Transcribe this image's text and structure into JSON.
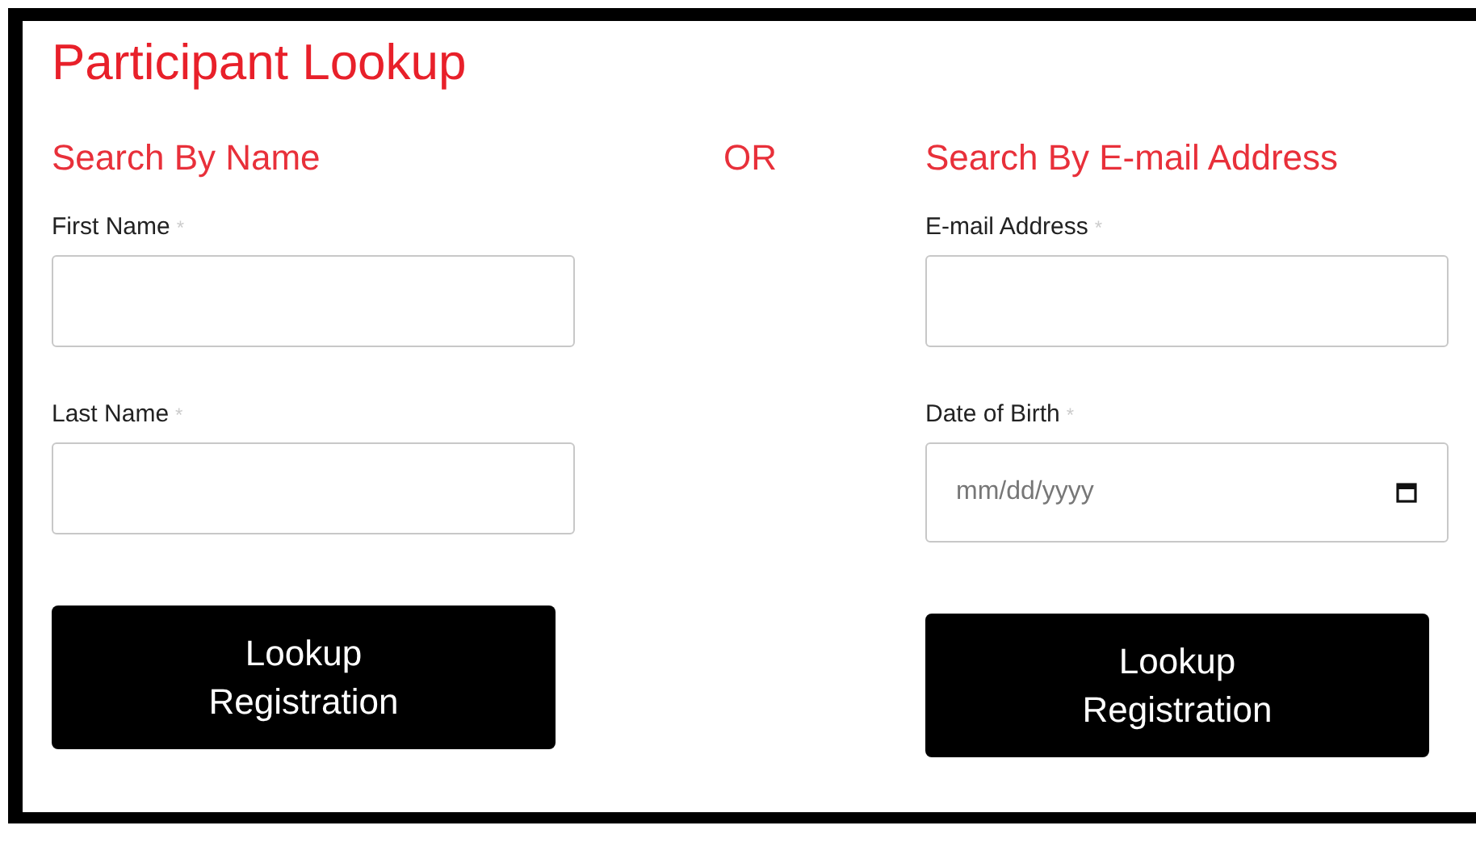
{
  "title": "Participant Lookup",
  "separator": "OR",
  "sections": [
    {
      "heading": "Search By Name",
      "fields": [
        {
          "kind": "text",
          "label": "First Name",
          "required_mark": "*"
        },
        {
          "kind": "text",
          "label": "Last Name",
          "required_mark": "*"
        }
      ],
      "button": "Lookup Registration"
    },
    {
      "heading": "Search By E-mail Address",
      "fields": [
        {
          "kind": "text",
          "label": "E-mail Address",
          "required_mark": "*"
        },
        {
          "kind": "date",
          "label": "Date of Birth",
          "required_mark": "*",
          "placeholder": "mm/dd/yyyy"
        }
      ],
      "button": "Lookup Registration"
    }
  ]
}
